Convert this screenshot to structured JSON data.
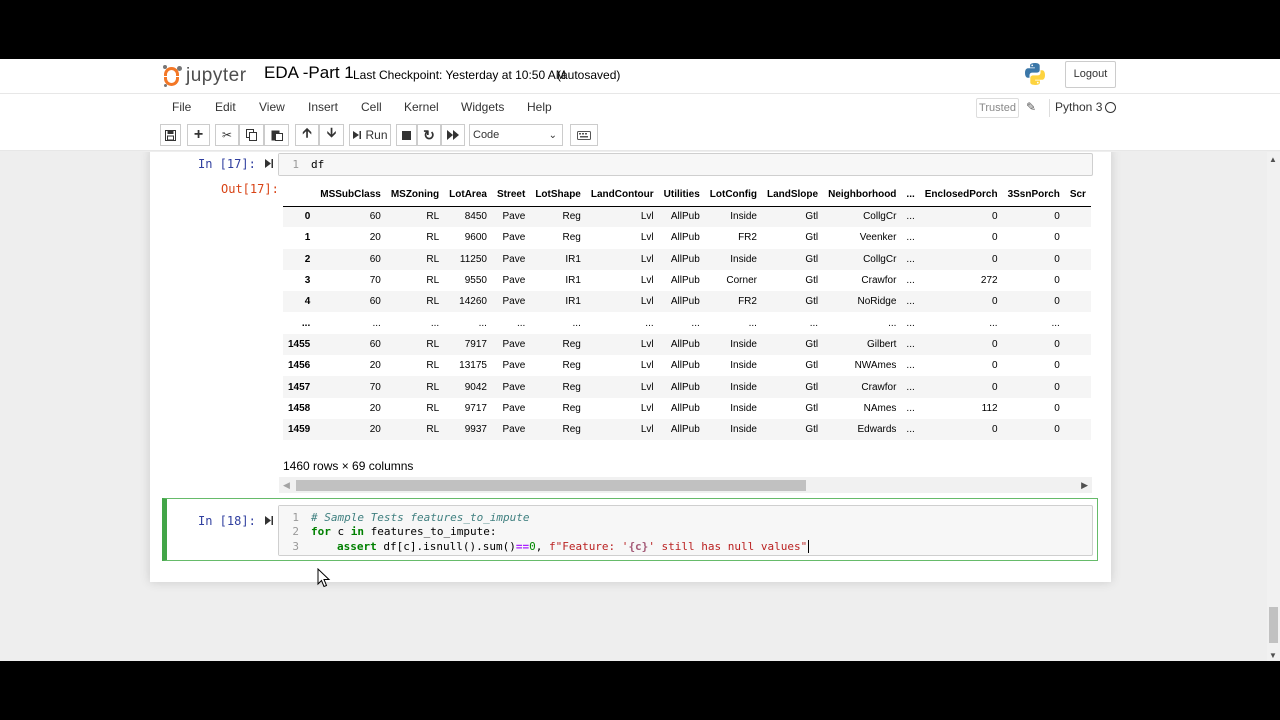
{
  "header": {
    "logo_text": "jupyter",
    "notebook_name": "EDA -Part 1",
    "checkpoint": "Last Checkpoint: Yesterday at 10:50 AM",
    "autosave": "(autosaved)",
    "logout_label": "Logout"
  },
  "menu": {
    "items": [
      "File",
      "Edit",
      "View",
      "Insert",
      "Cell",
      "Kernel",
      "Widgets",
      "Help"
    ],
    "trusted": "Trusted",
    "kernel": "Python 3"
  },
  "toolbar": {
    "run_label": "Run",
    "cell_type": "Code"
  },
  "cells": {
    "c17": {
      "in_prompt": "In [17]:",
      "out_prompt": "Out[17]:",
      "line_numbers": [
        "1"
      ],
      "code": "df"
    },
    "c18": {
      "in_prompt": "In [18]:",
      "line_numbers": [
        "1",
        "2",
        "3"
      ],
      "line1": "# Sample Tests features_to_impute",
      "line2_kw1": "for",
      "line2_mid": " c ",
      "line2_kw2": "in",
      "line2_rest": " features_to_impute:",
      "line3_kw": "assert",
      "line3_a": " df[c].isnull().sum()",
      "line3_op": "==",
      "line3_num": "0",
      "line3_b": ", ",
      "line3_str1": "f\"Feature: '",
      "line3_fmt": "{c}",
      "line3_str2": "' still has null values\""
    }
  },
  "dataframe": {
    "columns": [
      "",
      "MSSubClass",
      "MSZoning",
      "LotArea",
      "Street",
      "LotShape",
      "LandContour",
      "Utilities",
      "LotConfig",
      "LandSlope",
      "Neighborhood",
      "...",
      "EnclosedPorch",
      "3SsnPorch",
      "Scr"
    ],
    "rows": [
      [
        "0",
        "60",
        "RL",
        "8450",
        "Pave",
        "Reg",
        "Lvl",
        "AllPub",
        "Inside",
        "Gtl",
        "CollgCr",
        "...",
        "0",
        "0",
        ""
      ],
      [
        "1",
        "20",
        "RL",
        "9600",
        "Pave",
        "Reg",
        "Lvl",
        "AllPub",
        "FR2",
        "Gtl",
        "Veenker",
        "...",
        "0",
        "0",
        ""
      ],
      [
        "2",
        "60",
        "RL",
        "11250",
        "Pave",
        "IR1",
        "Lvl",
        "AllPub",
        "Inside",
        "Gtl",
        "CollgCr",
        "...",
        "0",
        "0",
        ""
      ],
      [
        "3",
        "70",
        "RL",
        "9550",
        "Pave",
        "IR1",
        "Lvl",
        "AllPub",
        "Corner",
        "Gtl",
        "Crawfor",
        "...",
        "272",
        "0",
        ""
      ],
      [
        "4",
        "60",
        "RL",
        "14260",
        "Pave",
        "IR1",
        "Lvl",
        "AllPub",
        "FR2",
        "Gtl",
        "NoRidge",
        "...",
        "0",
        "0",
        ""
      ],
      [
        "...",
        "...",
        "...",
        "...",
        "...",
        "...",
        "...",
        "...",
        "...",
        "...",
        "...",
        "...",
        "...",
        "...",
        ""
      ],
      [
        "1455",
        "60",
        "RL",
        "7917",
        "Pave",
        "Reg",
        "Lvl",
        "AllPub",
        "Inside",
        "Gtl",
        "Gilbert",
        "...",
        "0",
        "0",
        ""
      ],
      [
        "1456",
        "20",
        "RL",
        "13175",
        "Pave",
        "Reg",
        "Lvl",
        "AllPub",
        "Inside",
        "Gtl",
        "NWAmes",
        "...",
        "0",
        "0",
        ""
      ],
      [
        "1457",
        "70",
        "RL",
        "9042",
        "Pave",
        "Reg",
        "Lvl",
        "AllPub",
        "Inside",
        "Gtl",
        "Crawfor",
        "...",
        "0",
        "0",
        ""
      ],
      [
        "1458",
        "20",
        "RL",
        "9717",
        "Pave",
        "Reg",
        "Lvl",
        "AllPub",
        "Inside",
        "Gtl",
        "NAmes",
        "...",
        "112",
        "0",
        ""
      ],
      [
        "1459",
        "20",
        "RL",
        "9937",
        "Pave",
        "Reg",
        "Lvl",
        "AllPub",
        "Inside",
        "Gtl",
        "Edwards",
        "...",
        "0",
        "0",
        ""
      ]
    ],
    "shape": "1460 rows × 69 columns"
  },
  "colors": {
    "orange_logo": "#f37726",
    "in_prompt": "#303f9f",
    "out_prompt": "#d84315",
    "selected_cell_border": "#42a548"
  }
}
